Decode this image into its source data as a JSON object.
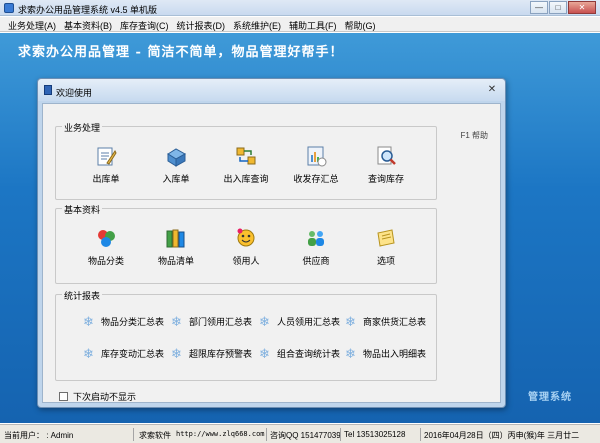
{
  "window": {
    "title": "求索办公用品管理系统 v4.5 单机版",
    "controls": [
      "—",
      "□",
      "✕"
    ]
  },
  "menu": [
    "业务处理(A)",
    "基本资料(B)",
    "库存查询(C)",
    "统计报表(D)",
    "系统维护(E)",
    "辅助工具(F)",
    "帮助(G)"
  ],
  "banner": {
    "slogan": "求索办公用品管理 - 简洁不简单，物品管理好帮手！",
    "watermark": "管理系统"
  },
  "dialog": {
    "title": "欢迎使用",
    "close": "✕",
    "help": "F1 帮助",
    "groups": {
      "business": {
        "label": "业务处理",
        "items": [
          "出库单",
          "入库单",
          "出入库查询",
          "收发存汇总",
          "查询库存"
        ]
      },
      "basic": {
        "label": "基本资料",
        "items": [
          "物品分类",
          "物品清单",
          "领用人",
          "供应商",
          "选项"
        ]
      },
      "reports": {
        "label": "统计报表",
        "items": [
          "物品分类汇总表",
          "部门领用汇总表",
          "人员领用汇总表",
          "商家供货汇总表",
          "库存变动汇总表",
          "超限库存预警表",
          "组合查询统计表",
          "物品出入明细表"
        ]
      }
    },
    "dont_show": "下次启动不显示"
  },
  "status": {
    "user": "当前用户： : Admin",
    "company": "求索软件",
    "url": "http://www.zlq668.com",
    "qq": "咨询QQ 151477039",
    "tel": "Tel 13513025128",
    "date": "2016年04月28日（四）丙申(猴)年 三月廿二"
  },
  "colors": {
    "workspace": "#1c76c4",
    "dialog_frame": "#bfd5ec",
    "panel": "#f1f1f1"
  }
}
